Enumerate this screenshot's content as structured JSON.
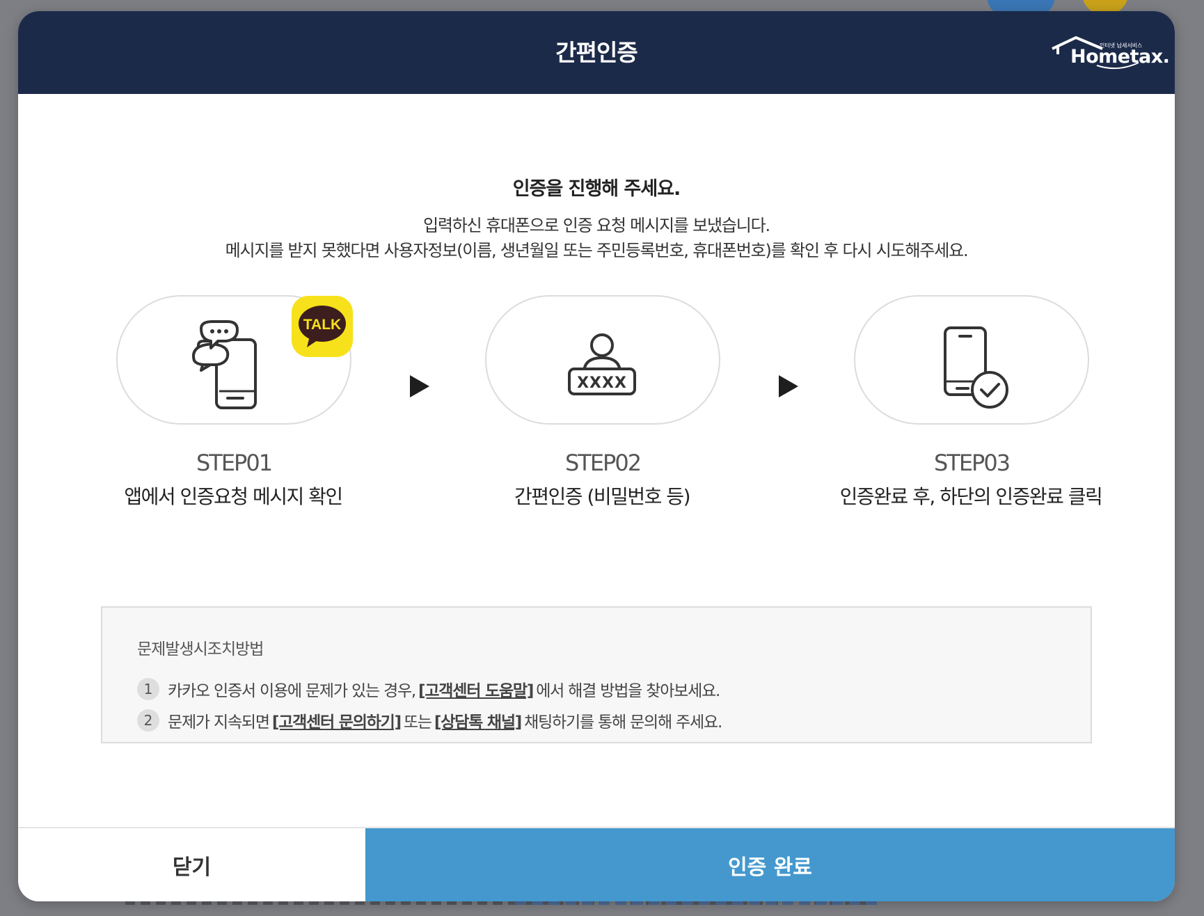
{
  "modal": {
    "title": "간편인증",
    "logo": {
      "text": "Hometax.",
      "subtext": "인터넷 납세서비스"
    }
  },
  "content": {
    "lead": "인증을 진행해 주세요.",
    "desc_line1": "입력하신 휴대폰으로 인증 요청 메시지를 보냈습니다.",
    "desc_line2": "메시지를 받지 못했다면 사용자정보(이름, 생년월일 또는 주민등록번호, 휴대폰번호)를 확인 후 다시 시도해주세요."
  },
  "steps": [
    {
      "num": "STEP01",
      "label": "앱에서 인증요청 메시지 확인",
      "icon": "chat-phone-icon",
      "badge": "TALK"
    },
    {
      "num": "STEP02",
      "label": "간편인증 (비밀번호 등)",
      "icon": "user-password-icon",
      "password_mask": "XXXX"
    },
    {
      "num": "STEP03",
      "label": "인증완료 후, 하단의 인증완료 클릭",
      "icon": "phone-check-icon"
    }
  ],
  "trouble": {
    "title": "문제발생시조치방법",
    "items": [
      {
        "num": "1",
        "text_before": "카카오 인증서 이용에 문제가 있는 경우,",
        "link1": "[고객센터 도움말]",
        "text_after": "에서 해결 방법을 찾아보세요."
      },
      {
        "num": "2",
        "text_before": "문제가 지속되면",
        "link1": "[고객센터 문의하기]",
        "text_mid": "또는",
        "link2": "[상담톡 채널]",
        "text_after": "채팅하기를 통해 문의해 주세요."
      }
    ]
  },
  "footer": {
    "close_label": "닫기",
    "done_label": "인증 완료"
  },
  "colors": {
    "header_bg": "#1c2a4a",
    "primary": "#4498ce",
    "talk_yellow": "#f7e11a"
  }
}
